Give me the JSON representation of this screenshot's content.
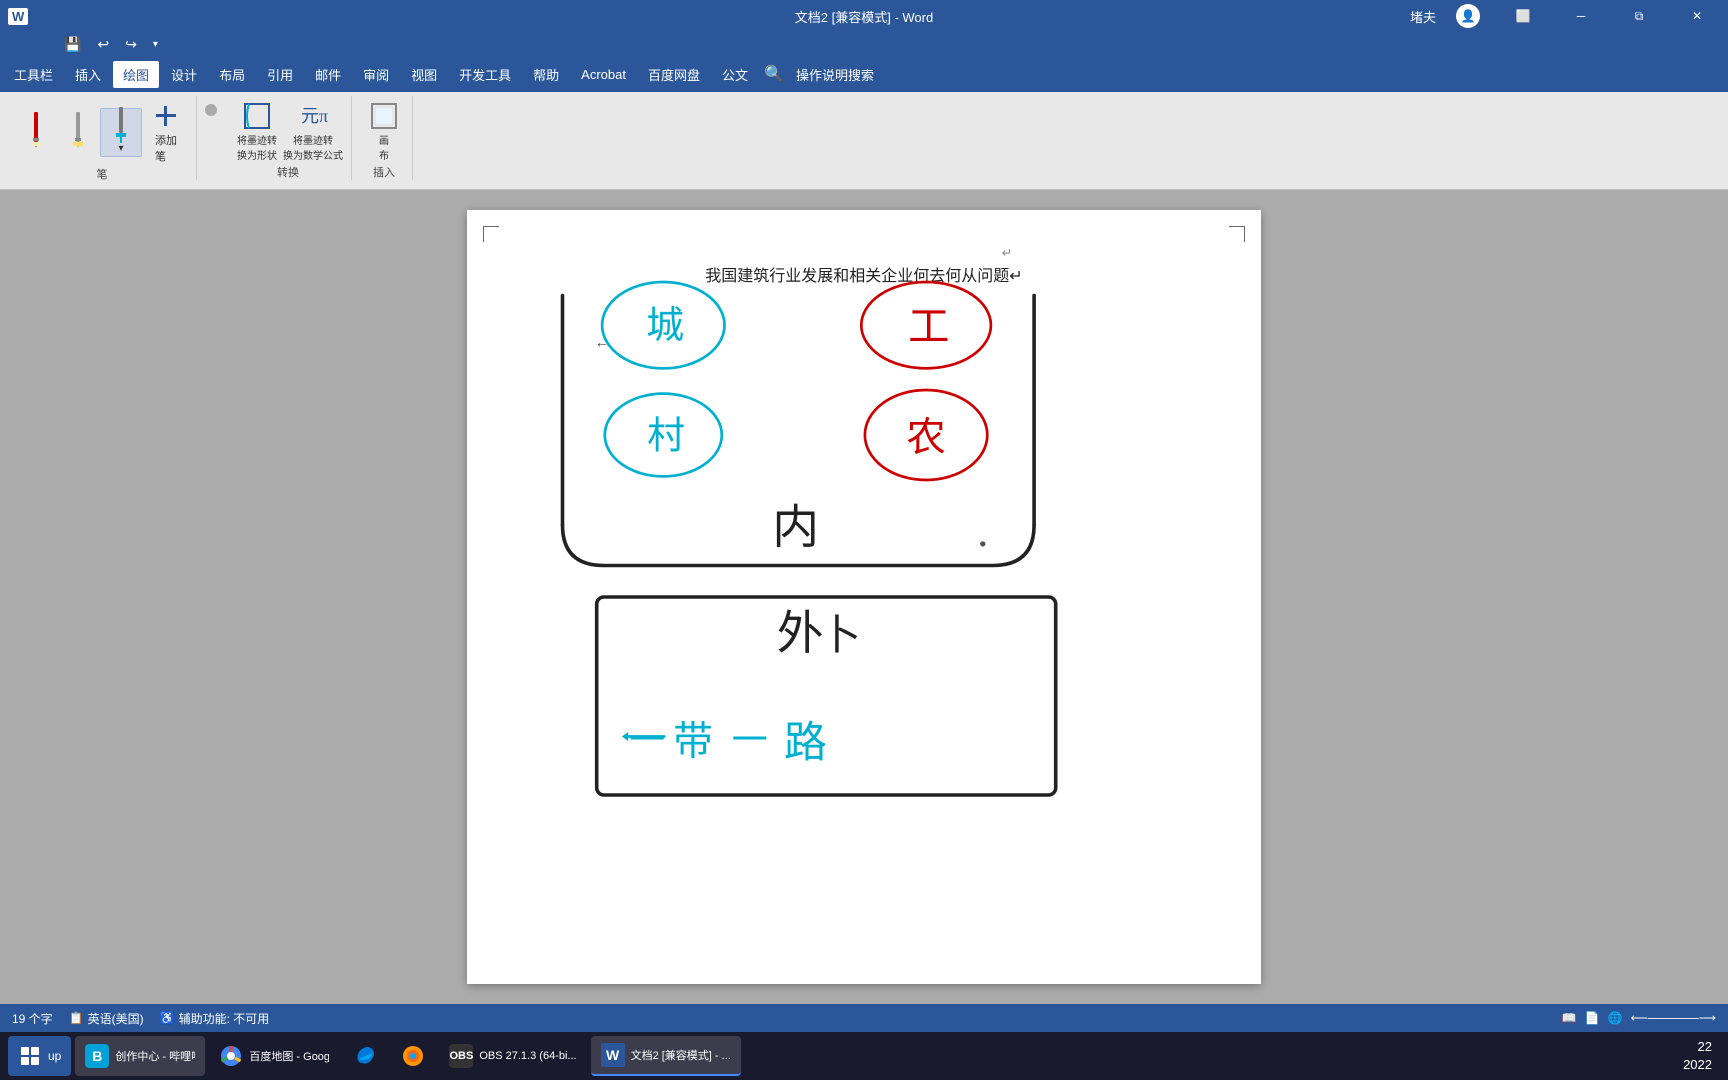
{
  "titlebar": {
    "title": "文档2 [兼容模式] - Word",
    "user": "堵夫",
    "minimize": "─",
    "restore": "⧉",
    "close": "✕"
  },
  "qat": {
    "items": [
      "↩",
      "↪",
      "⚙"
    ]
  },
  "menubar": {
    "items": [
      "工具栏",
      "插入",
      "绘图",
      "设计",
      "布局",
      "引用",
      "邮件",
      "审阅",
      "视图",
      "开发工具",
      "帮助",
      "Acrobat",
      "百度网盘",
      "公文",
      "操作说明搜索"
    ]
  },
  "ribbon": {
    "pen_group_label": "笔",
    "convert_group_label": "转换",
    "insert_group_label": "插入",
    "add_pen_label": "添加\n笔",
    "to_shape_label": "将墨迹转\n换为形状",
    "to_math_label": "将墨迹转\n换为数学公式",
    "draw_label": "画\n布"
  },
  "page": {
    "title": "我国建筑行业发展和相关企业何去何从问题↵"
  },
  "statusbar": {
    "word_count": "19 个字",
    "language": "英语(美国)",
    "accessibility": "辅助功能: 不可用"
  },
  "taskbar": {
    "start_label": "up",
    "items": [
      {
        "label": "创作中心 - 哔哩哔...",
        "color": "#00a1d6"
      },
      {
        "label": "百度地图 - Googl...",
        "color": "#4285f4"
      },
      {
        "label": "",
        "color": "#0078d7"
      },
      {
        "label": "",
        "color": "#ff6600"
      },
      {
        "label": "OBS 27.1.3 (64-bi...",
        "color": "#333"
      },
      {
        "label": "文档2 [兼容模式] - ...",
        "color": "#2b579a"
      }
    ],
    "time": "22",
    "date": "2022"
  },
  "drawing": {
    "page_title": "我国建筑行业发展和相关企业何去何从问题↵"
  },
  "icons": {
    "search": "🔍"
  }
}
